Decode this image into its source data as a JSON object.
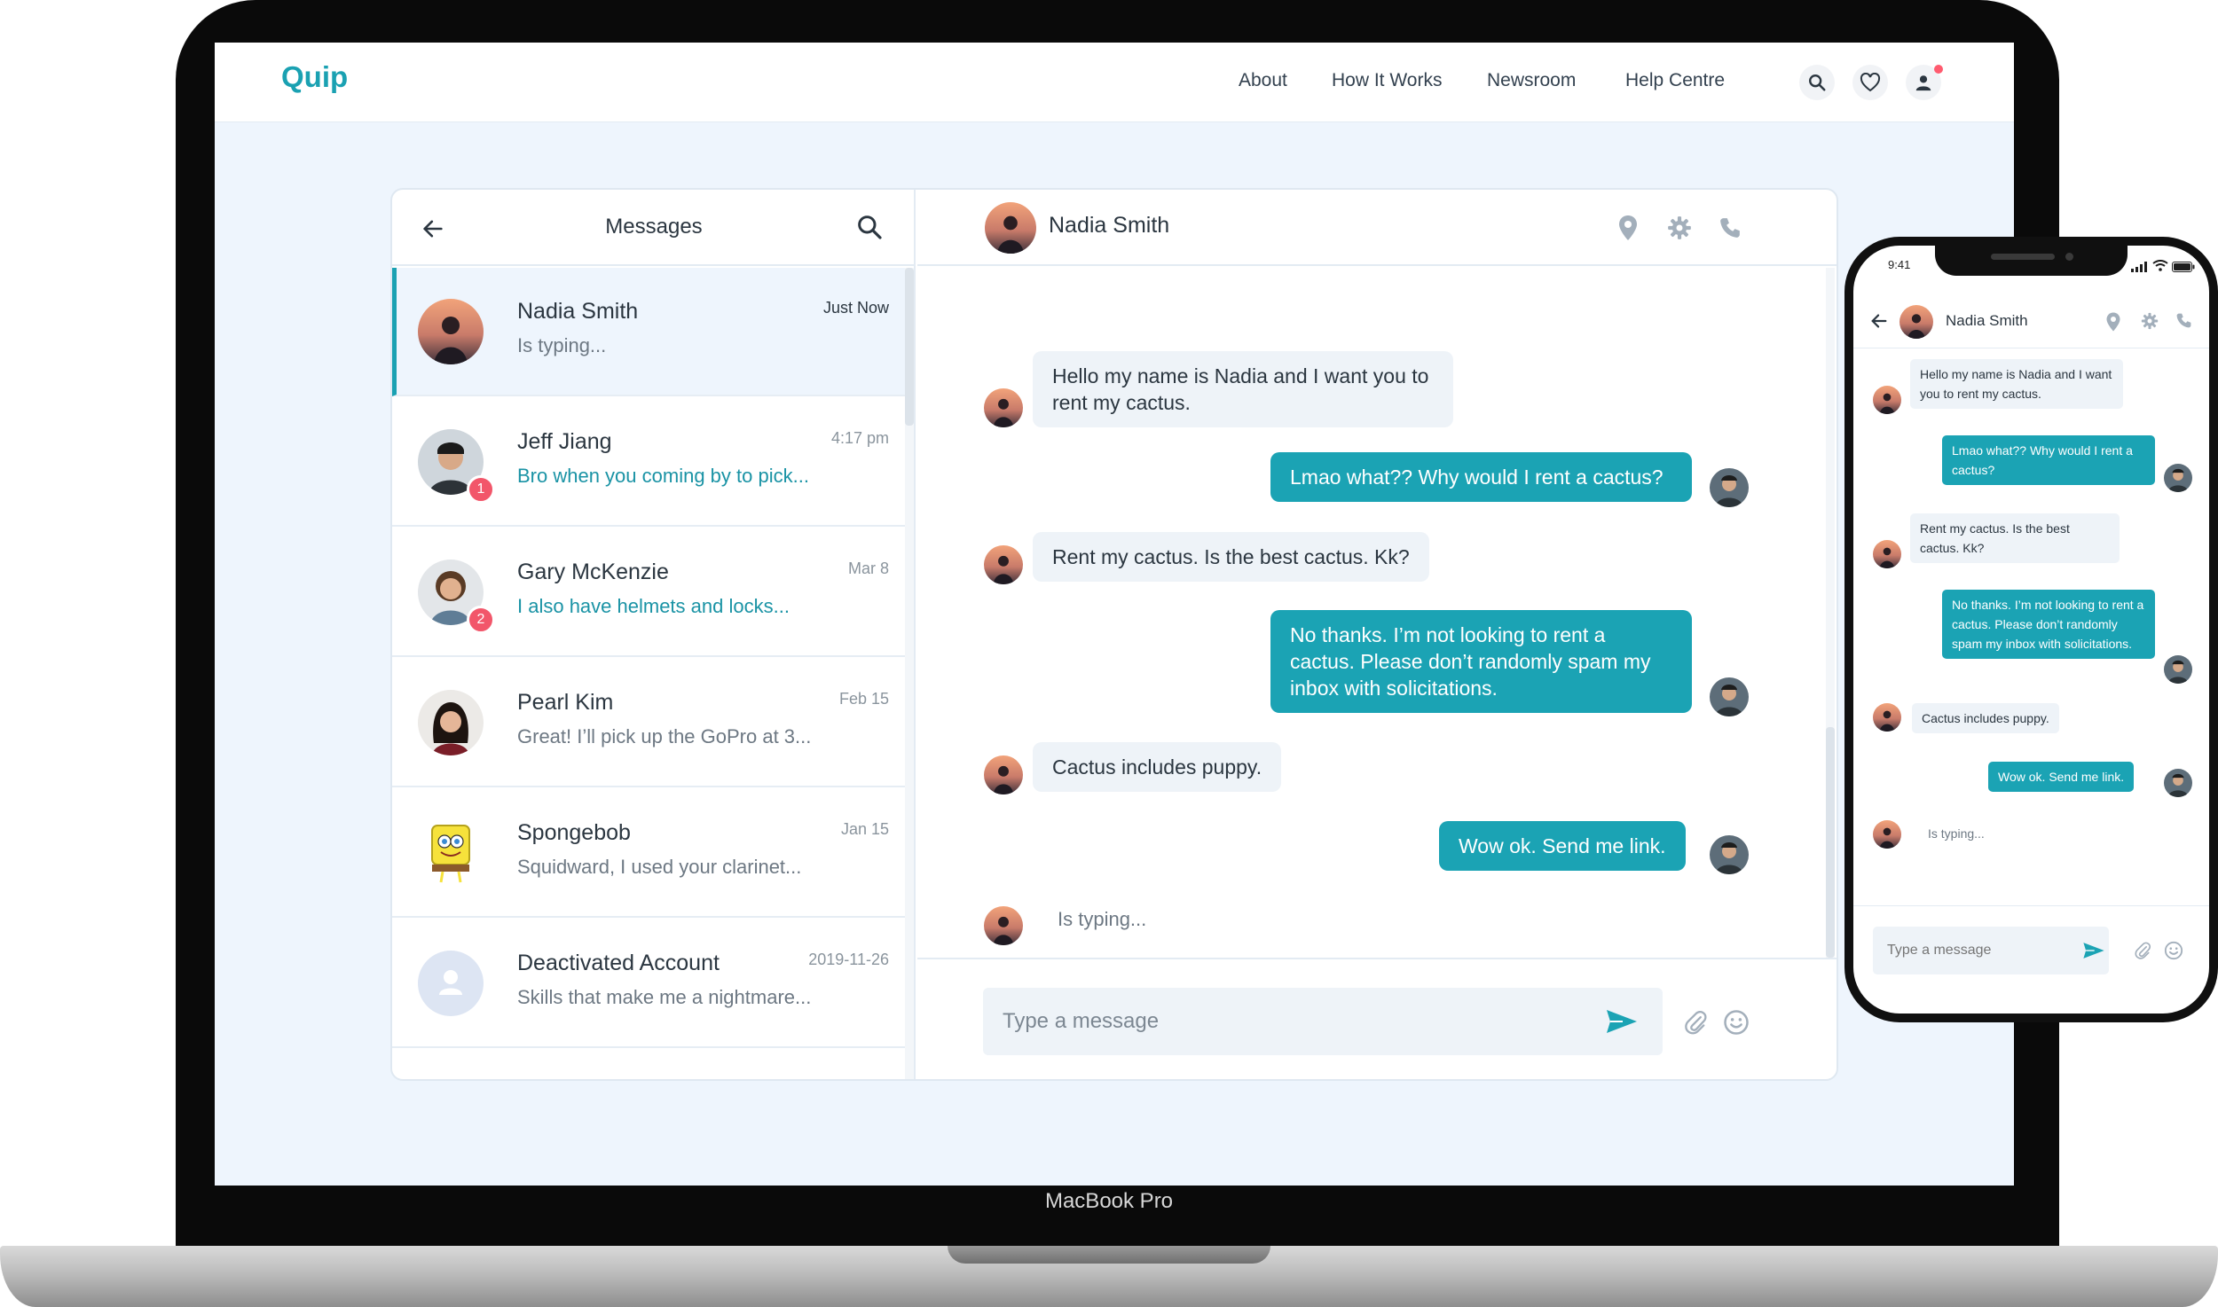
{
  "device": {
    "laptop_model": "MacBook Pro"
  },
  "nav": {
    "brand": "Quip",
    "links": [
      "About",
      "How It Works",
      "Newsroom",
      "Help Centre"
    ],
    "icons": [
      "search-icon",
      "heart-icon",
      "user-icon"
    ]
  },
  "messages_panel": {
    "title": "Messages",
    "conversations": [
      {
        "name": "Nadia Smith",
        "preview": "Is typing...",
        "time": "Just Now",
        "active": true,
        "unread": 0
      },
      {
        "name": "Jeff Jiang",
        "preview": "Bro when you coming by to pick...",
        "time": "4:17 pm",
        "active": false,
        "unread": 1
      },
      {
        "name": "Gary McKenzie",
        "preview": "I also have helmets and locks...",
        "time": "Mar 8",
        "active": false,
        "unread": 2
      },
      {
        "name": "Pearl Kim",
        "preview": "Great! I’ll pick up the GoPro at 3...",
        "time": "Feb 15",
        "active": false,
        "unread": 0
      },
      {
        "name": "Spongebob",
        "preview": "Squidward, I used your clarinet...",
        "time": "Jan 15",
        "active": false,
        "unread": 0
      },
      {
        "name": "Deactivated Account",
        "preview": "Skills that make me a nightmare...",
        "time": "2019-11-26",
        "active": false,
        "unread": 0
      }
    ]
  },
  "chat": {
    "contact": "Nadia Smith",
    "header_icons": [
      "location-pin-icon",
      "gear-icon",
      "phone-icon"
    ],
    "messages": [
      {
        "from": "them",
        "text": "Hello my name is Nadia and I want you to rent my cactus."
      },
      {
        "from": "me",
        "text": "Lmao what?? Why would I rent a cactus?"
      },
      {
        "from": "them",
        "text": "Rent my cactus. Is the best cactus. Kk?"
      },
      {
        "from": "me",
        "text": "No thanks. I’m not looking to rent a cactus. Please don’t randomly spam my inbox with solicitations."
      },
      {
        "from": "them",
        "text": "Cactus includes puppy."
      },
      {
        "from": "me",
        "text": "Wow ok. Send me link."
      }
    ],
    "typing_text": "Is typing...",
    "composer_placeholder": "Type a message"
  },
  "phone": {
    "status_time": "9:41",
    "contact": "Nadia Smith",
    "typing_text": "Is typing...",
    "composer_placeholder": "Type a message"
  },
  "colors": {
    "accent": "#1ba3b4",
    "badge": "#f2566a",
    "screen_bg": "#eef5fd"
  }
}
